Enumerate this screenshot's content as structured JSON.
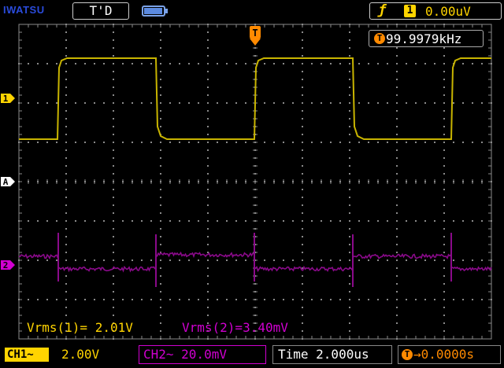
{
  "header": {
    "brand": "IWATSU",
    "trigger_status": "T'D",
    "trigger_slope_icon": "rising-edge-icon",
    "trigger_source": "1",
    "trigger_level": "0.00uV"
  },
  "frequency_readout": {
    "icon": "T",
    "value": "99.9979kHz"
  },
  "markers": {
    "trigger_position": "T",
    "ch1": "1",
    "ref": "A",
    "ch2": "2"
  },
  "measurements": {
    "vrms1": "Vrms(1)= 2.01V",
    "vrms2": "Vrms(2)=3.40mV"
  },
  "footer": {
    "ch1_tag": "CH1~",
    "ch1_scale": "2.00V",
    "ch2": "CH2~ 20.0mV",
    "timebase": "Time 2.000us",
    "trigger_position_icon": "T",
    "trigger_position": "→0.0000s"
  },
  "colors": {
    "ch1": "#c8b400",
    "ch1_text": "#ffd400",
    "ch2": "#8a0a8a",
    "ch2_text": "#d100d1",
    "grid": "#8a8a8a",
    "trigger": "#ff8a00",
    "brand": "#2a4bdb"
  },
  "waveforms": {
    "ch1": {
      "type": "square",
      "frequency_khz": 99.9979,
      "scale_v_per_div": 2.0,
      "vrms_v": 2.01
    },
    "ch2": {
      "type": "square-with-spikes",
      "scale_mv_per_div": 20.0,
      "vrms_mv": 3.4
    },
    "timebase_us_per_div": 2.0,
    "battery_level": 0.95
  }
}
